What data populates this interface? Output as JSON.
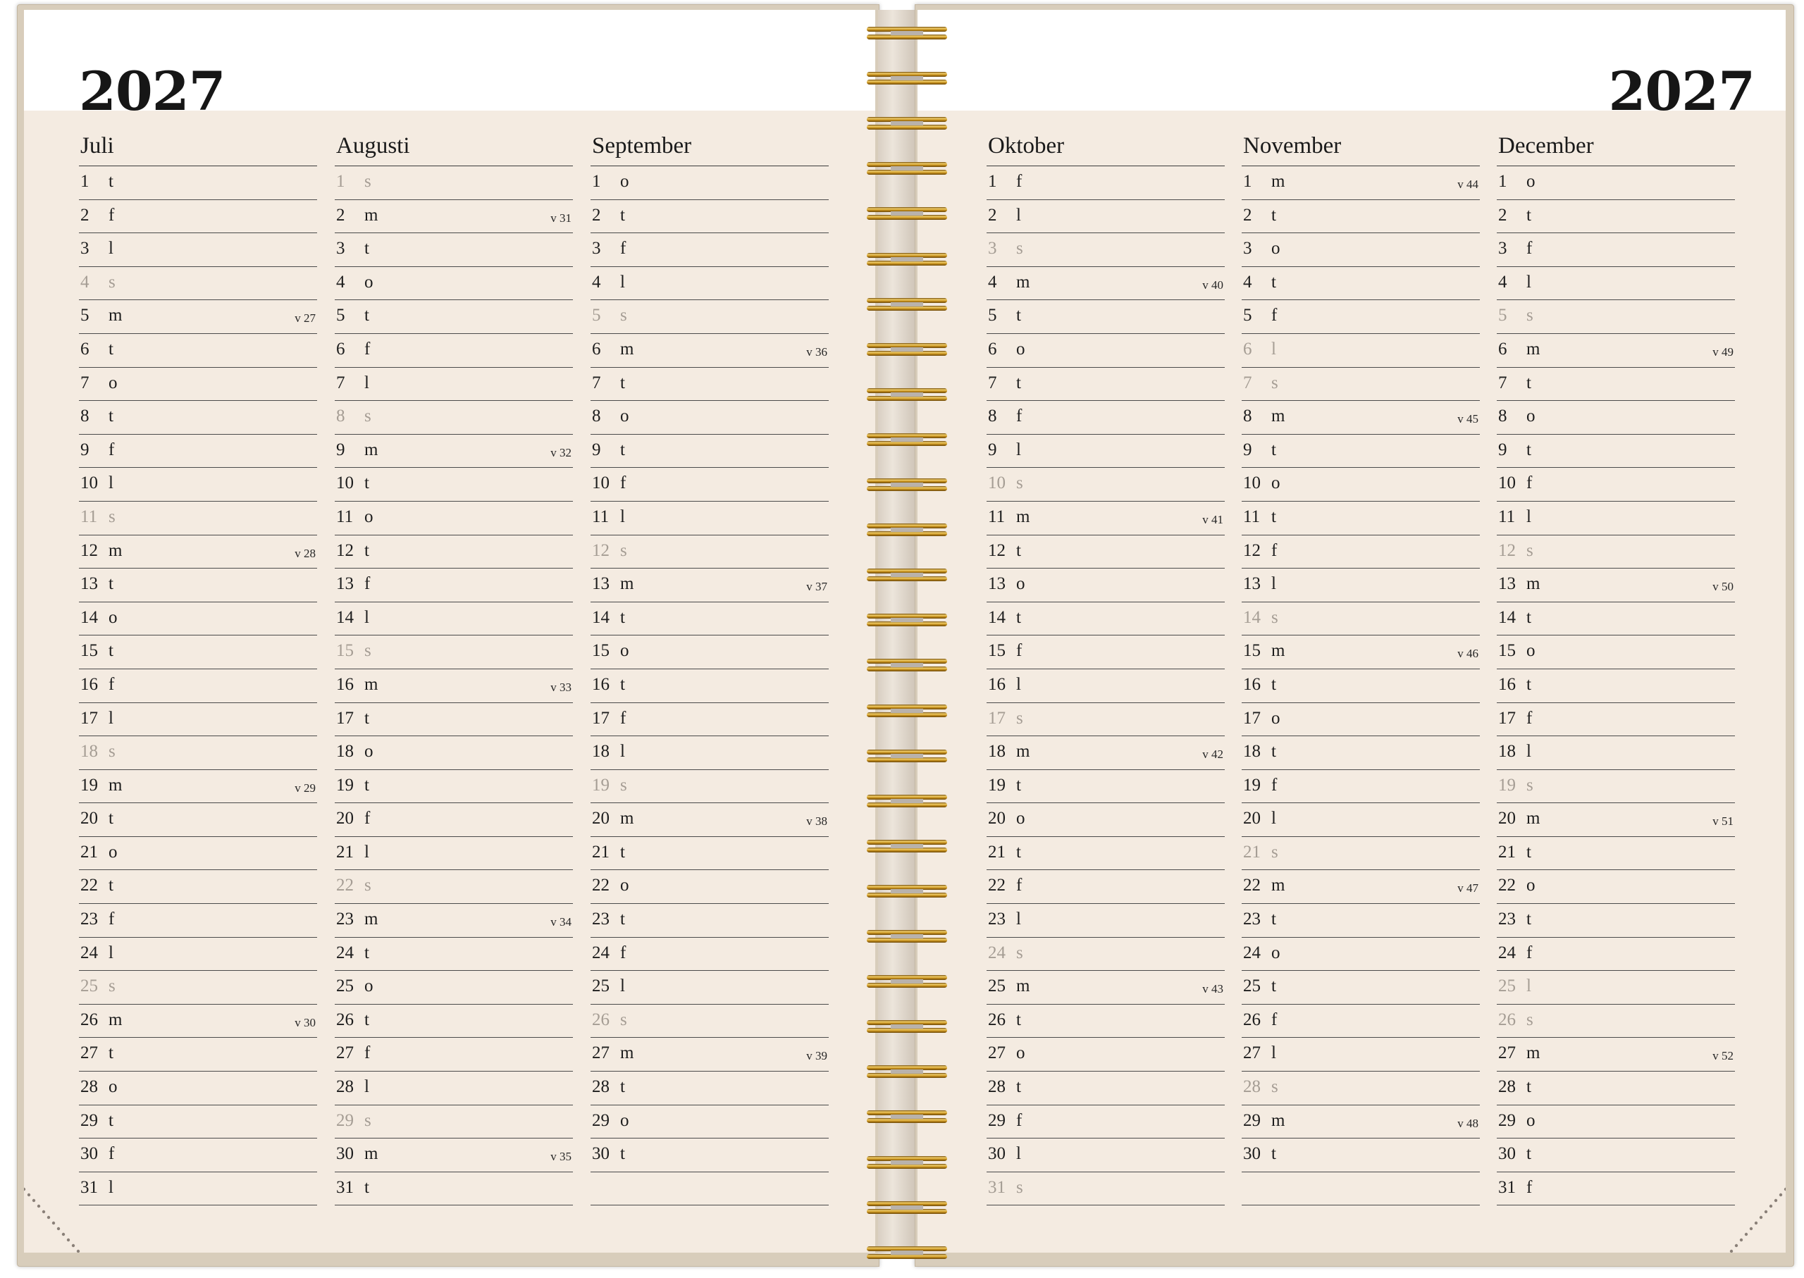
{
  "left_page": {
    "year": "2027"
  },
  "right_page": {
    "year": "2027"
  },
  "colors": {
    "page": "#f4ebe1",
    "cover": "#d8cdbb",
    "ring": "#d8a530",
    "weekend_text": "#a59d94"
  },
  "months": [
    {
      "name": "Juli",
      "days": [
        {
          "d": "1",
          "w": "t"
        },
        {
          "d": "2",
          "w": "f"
        },
        {
          "d": "3",
          "w": "l"
        },
        {
          "d": "4",
          "w": "s",
          "we": true
        },
        {
          "d": "5",
          "w": "m",
          "wk": "v 27"
        },
        {
          "d": "6",
          "w": "t"
        },
        {
          "d": "7",
          "w": "o"
        },
        {
          "d": "8",
          "w": "t"
        },
        {
          "d": "9",
          "w": "f"
        },
        {
          "d": "10",
          "w": "l"
        },
        {
          "d": "11",
          "w": "s",
          "we": true
        },
        {
          "d": "12",
          "w": "m",
          "wk": "v 28"
        },
        {
          "d": "13",
          "w": "t"
        },
        {
          "d": "14",
          "w": "o"
        },
        {
          "d": "15",
          "w": "t"
        },
        {
          "d": "16",
          "w": "f"
        },
        {
          "d": "17",
          "w": "l"
        },
        {
          "d": "18",
          "w": "s",
          "we": true
        },
        {
          "d": "19",
          "w": "m",
          "wk": "v 29"
        },
        {
          "d": "20",
          "w": "t"
        },
        {
          "d": "21",
          "w": "o"
        },
        {
          "d": "22",
          "w": "t"
        },
        {
          "d": "23",
          "w": "f"
        },
        {
          "d": "24",
          "w": "l"
        },
        {
          "d": "25",
          "w": "s",
          "we": true
        },
        {
          "d": "26",
          "w": "m",
          "wk": "v 30"
        },
        {
          "d": "27",
          "w": "t"
        },
        {
          "d": "28",
          "w": "o"
        },
        {
          "d": "29",
          "w": "t"
        },
        {
          "d": "30",
          "w": "f"
        },
        {
          "d": "31",
          "w": "l"
        }
      ]
    },
    {
      "name": "Augusti",
      "days": [
        {
          "d": "1",
          "w": "s",
          "we": true
        },
        {
          "d": "2",
          "w": "m",
          "wk": "v 31"
        },
        {
          "d": "3",
          "w": "t"
        },
        {
          "d": "4",
          "w": "o"
        },
        {
          "d": "5",
          "w": "t"
        },
        {
          "d": "6",
          "w": "f"
        },
        {
          "d": "7",
          "w": "l"
        },
        {
          "d": "8",
          "w": "s",
          "we": true
        },
        {
          "d": "9",
          "w": "m",
          "wk": "v 32"
        },
        {
          "d": "10",
          "w": "t"
        },
        {
          "d": "11",
          "w": "o"
        },
        {
          "d": "12",
          "w": "t"
        },
        {
          "d": "13",
          "w": "f"
        },
        {
          "d": "14",
          "w": "l"
        },
        {
          "d": "15",
          "w": "s",
          "we": true
        },
        {
          "d": "16",
          "w": "m",
          "wk": "v 33"
        },
        {
          "d": "17",
          "w": "t"
        },
        {
          "d": "18",
          "w": "o"
        },
        {
          "d": "19",
          "w": "t"
        },
        {
          "d": "20",
          "w": "f"
        },
        {
          "d": "21",
          "w": "l"
        },
        {
          "d": "22",
          "w": "s",
          "we": true
        },
        {
          "d": "23",
          "w": "m",
          "wk": "v 34"
        },
        {
          "d": "24",
          "w": "t"
        },
        {
          "d": "25",
          "w": "o"
        },
        {
          "d": "26",
          "w": "t"
        },
        {
          "d": "27",
          "w": "f"
        },
        {
          "d": "28",
          "w": "l"
        },
        {
          "d": "29",
          "w": "s",
          "we": true
        },
        {
          "d": "30",
          "w": "m",
          "wk": "v 35"
        },
        {
          "d": "31",
          "w": "t"
        }
      ]
    },
    {
      "name": "September",
      "days": [
        {
          "d": "1",
          "w": "o"
        },
        {
          "d": "2",
          "w": "t"
        },
        {
          "d": "3",
          "w": "f"
        },
        {
          "d": "4",
          "w": "l"
        },
        {
          "d": "5",
          "w": "s",
          "we": true
        },
        {
          "d": "6",
          "w": "m",
          "wk": "v 36"
        },
        {
          "d": "7",
          "w": "t"
        },
        {
          "d": "8",
          "w": "o"
        },
        {
          "d": "9",
          "w": "t"
        },
        {
          "d": "10",
          "w": "f"
        },
        {
          "d": "11",
          "w": "l"
        },
        {
          "d": "12",
          "w": "s",
          "we": true
        },
        {
          "d": "13",
          "w": "m",
          "wk": "v 37"
        },
        {
          "d": "14",
          "w": "t"
        },
        {
          "d": "15",
          "w": "o"
        },
        {
          "d": "16",
          "w": "t"
        },
        {
          "d": "17",
          "w": "f"
        },
        {
          "d": "18",
          "w": "l"
        },
        {
          "d": "19",
          "w": "s",
          "we": true
        },
        {
          "d": "20",
          "w": "m",
          "wk": "v 38"
        },
        {
          "d": "21",
          "w": "t"
        },
        {
          "d": "22",
          "w": "o"
        },
        {
          "d": "23",
          "w": "t"
        },
        {
          "d": "24",
          "w": "f"
        },
        {
          "d": "25",
          "w": "l"
        },
        {
          "d": "26",
          "w": "s",
          "we": true
        },
        {
          "d": "27",
          "w": "m",
          "wk": "v 39"
        },
        {
          "d": "28",
          "w": "t"
        },
        {
          "d": "29",
          "w": "o"
        },
        {
          "d": "30",
          "w": "t"
        }
      ]
    },
    {
      "name": "Oktober",
      "days": [
        {
          "d": "1",
          "w": "f"
        },
        {
          "d": "2",
          "w": "l"
        },
        {
          "d": "3",
          "w": "s",
          "we": true
        },
        {
          "d": "4",
          "w": "m",
          "wk": "v 40"
        },
        {
          "d": "5",
          "w": "t"
        },
        {
          "d": "6",
          "w": "o"
        },
        {
          "d": "7",
          "w": "t"
        },
        {
          "d": "8",
          "w": "f"
        },
        {
          "d": "9",
          "w": "l"
        },
        {
          "d": "10",
          "w": "s",
          "we": true
        },
        {
          "d": "11",
          "w": "m",
          "wk": "v 41"
        },
        {
          "d": "12",
          "w": "t"
        },
        {
          "d": "13",
          "w": "o"
        },
        {
          "d": "14",
          "w": "t"
        },
        {
          "d": "15",
          "w": "f"
        },
        {
          "d": "16",
          "w": "l"
        },
        {
          "d": "17",
          "w": "s",
          "we": true
        },
        {
          "d": "18",
          "w": "m",
          "wk": "v 42"
        },
        {
          "d": "19",
          "w": "t"
        },
        {
          "d": "20",
          "w": "o"
        },
        {
          "d": "21",
          "w": "t"
        },
        {
          "d": "22",
          "w": "f"
        },
        {
          "d": "23",
          "w": "l"
        },
        {
          "d": "24",
          "w": "s",
          "we": true
        },
        {
          "d": "25",
          "w": "m",
          "wk": "v 43"
        },
        {
          "d": "26",
          "w": "t"
        },
        {
          "d": "27",
          "w": "o"
        },
        {
          "d": "28",
          "w": "t"
        },
        {
          "d": "29",
          "w": "f"
        },
        {
          "d": "30",
          "w": "l"
        },
        {
          "d": "31",
          "w": "s",
          "we": true
        }
      ]
    },
    {
      "name": "November",
      "days": [
        {
          "d": "1",
          "w": "m",
          "wk": "v 44"
        },
        {
          "d": "2",
          "w": "t"
        },
        {
          "d": "3",
          "w": "o"
        },
        {
          "d": "4",
          "w": "t"
        },
        {
          "d": "5",
          "w": "f"
        },
        {
          "d": "6",
          "w": "l",
          "we": true
        },
        {
          "d": "7",
          "w": "s",
          "we": true
        },
        {
          "d": "8",
          "w": "m",
          "wk": "v 45"
        },
        {
          "d": "9",
          "w": "t"
        },
        {
          "d": "10",
          "w": "o"
        },
        {
          "d": "11",
          "w": "t"
        },
        {
          "d": "12",
          "w": "f"
        },
        {
          "d": "13",
          "w": "l"
        },
        {
          "d": "14",
          "w": "s",
          "we": true
        },
        {
          "d": "15",
          "w": "m",
          "wk": "v 46"
        },
        {
          "d": "16",
          "w": "t"
        },
        {
          "d": "17",
          "w": "o"
        },
        {
          "d": "18",
          "w": "t"
        },
        {
          "d": "19",
          "w": "f"
        },
        {
          "d": "20",
          "w": "l"
        },
        {
          "d": "21",
          "w": "s",
          "we": true
        },
        {
          "d": "22",
          "w": "m",
          "wk": "v 47"
        },
        {
          "d": "23",
          "w": "t"
        },
        {
          "d": "24",
          "w": "o"
        },
        {
          "d": "25",
          "w": "t"
        },
        {
          "d": "26",
          "w": "f"
        },
        {
          "d": "27",
          "w": "l"
        },
        {
          "d": "28",
          "w": "s",
          "we": true
        },
        {
          "d": "29",
          "w": "m",
          "wk": "v 48"
        },
        {
          "d": "30",
          "w": "t"
        }
      ]
    },
    {
      "name": "December",
      "days": [
        {
          "d": "1",
          "w": "o"
        },
        {
          "d": "2",
          "w": "t"
        },
        {
          "d": "3",
          "w": "f"
        },
        {
          "d": "4",
          "w": "l"
        },
        {
          "d": "5",
          "w": "s",
          "we": true
        },
        {
          "d": "6",
          "w": "m",
          "wk": "v 49"
        },
        {
          "d": "7",
          "w": "t"
        },
        {
          "d": "8",
          "w": "o"
        },
        {
          "d": "9",
          "w": "t"
        },
        {
          "d": "10",
          "w": "f"
        },
        {
          "d": "11",
          "w": "l"
        },
        {
          "d": "12",
          "w": "s",
          "we": true
        },
        {
          "d": "13",
          "w": "m",
          "wk": "v 50"
        },
        {
          "d": "14",
          "w": "t"
        },
        {
          "d": "15",
          "w": "o"
        },
        {
          "d": "16",
          "w": "t"
        },
        {
          "d": "17",
          "w": "f"
        },
        {
          "d": "18",
          "w": "l"
        },
        {
          "d": "19",
          "w": "s",
          "we": true
        },
        {
          "d": "20",
          "w": "m",
          "wk": "v 51"
        },
        {
          "d": "21",
          "w": "t"
        },
        {
          "d": "22",
          "w": "o"
        },
        {
          "d": "23",
          "w": "t"
        },
        {
          "d": "24",
          "w": "f"
        },
        {
          "d": "25",
          "w": "l",
          "we": true
        },
        {
          "d": "26",
          "w": "s",
          "we": true
        },
        {
          "d": "27",
          "w": "m",
          "wk": "v 52"
        },
        {
          "d": "28",
          "w": "t"
        },
        {
          "d": "29",
          "w": "o"
        },
        {
          "d": "30",
          "w": "t"
        },
        {
          "d": "31",
          "w": "f"
        }
      ]
    }
  ]
}
